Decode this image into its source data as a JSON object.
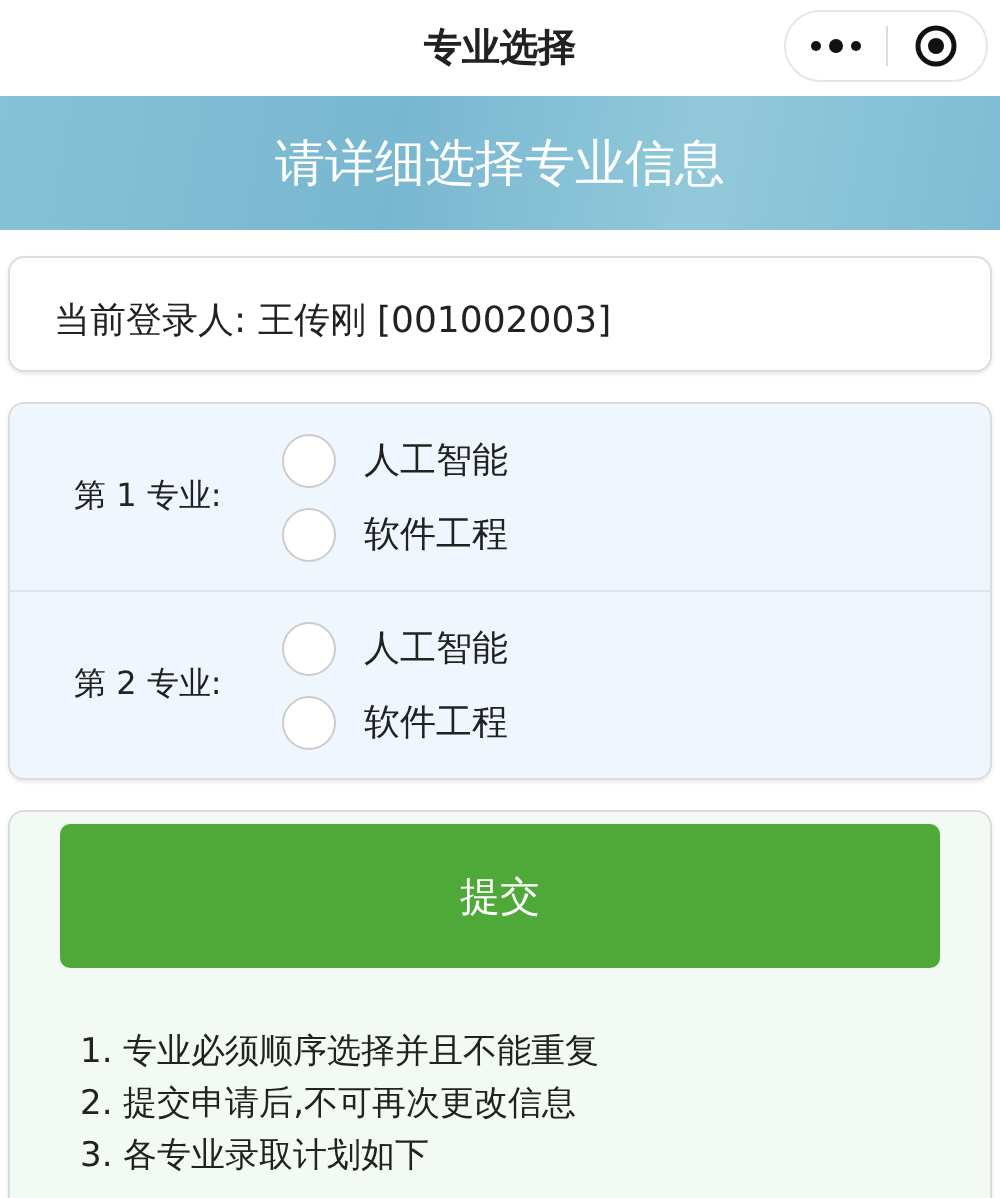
{
  "nav": {
    "title": "专业选择"
  },
  "banner": {
    "title": "请详细选择专业信息"
  },
  "user": {
    "text": "当前登录人: 王传刚 [001002003]"
  },
  "choices": [
    {
      "label": "第 1 专业:",
      "options": [
        {
          "label": "人工智能",
          "selected": false
        },
        {
          "label": "软件工程",
          "selected": false
        }
      ]
    },
    {
      "label": "第 2 专业:",
      "options": [
        {
          "label": "人工智能",
          "selected": false
        },
        {
          "label": "软件工程",
          "selected": false
        }
      ]
    }
  ],
  "submit": {
    "label": "提交"
  },
  "notes": [
    "1. 专业必须顺序选择并且不能重复",
    "2. 提交申请后,不可再次更改信息",
    "3. 各专业录取计划如下"
  ]
}
